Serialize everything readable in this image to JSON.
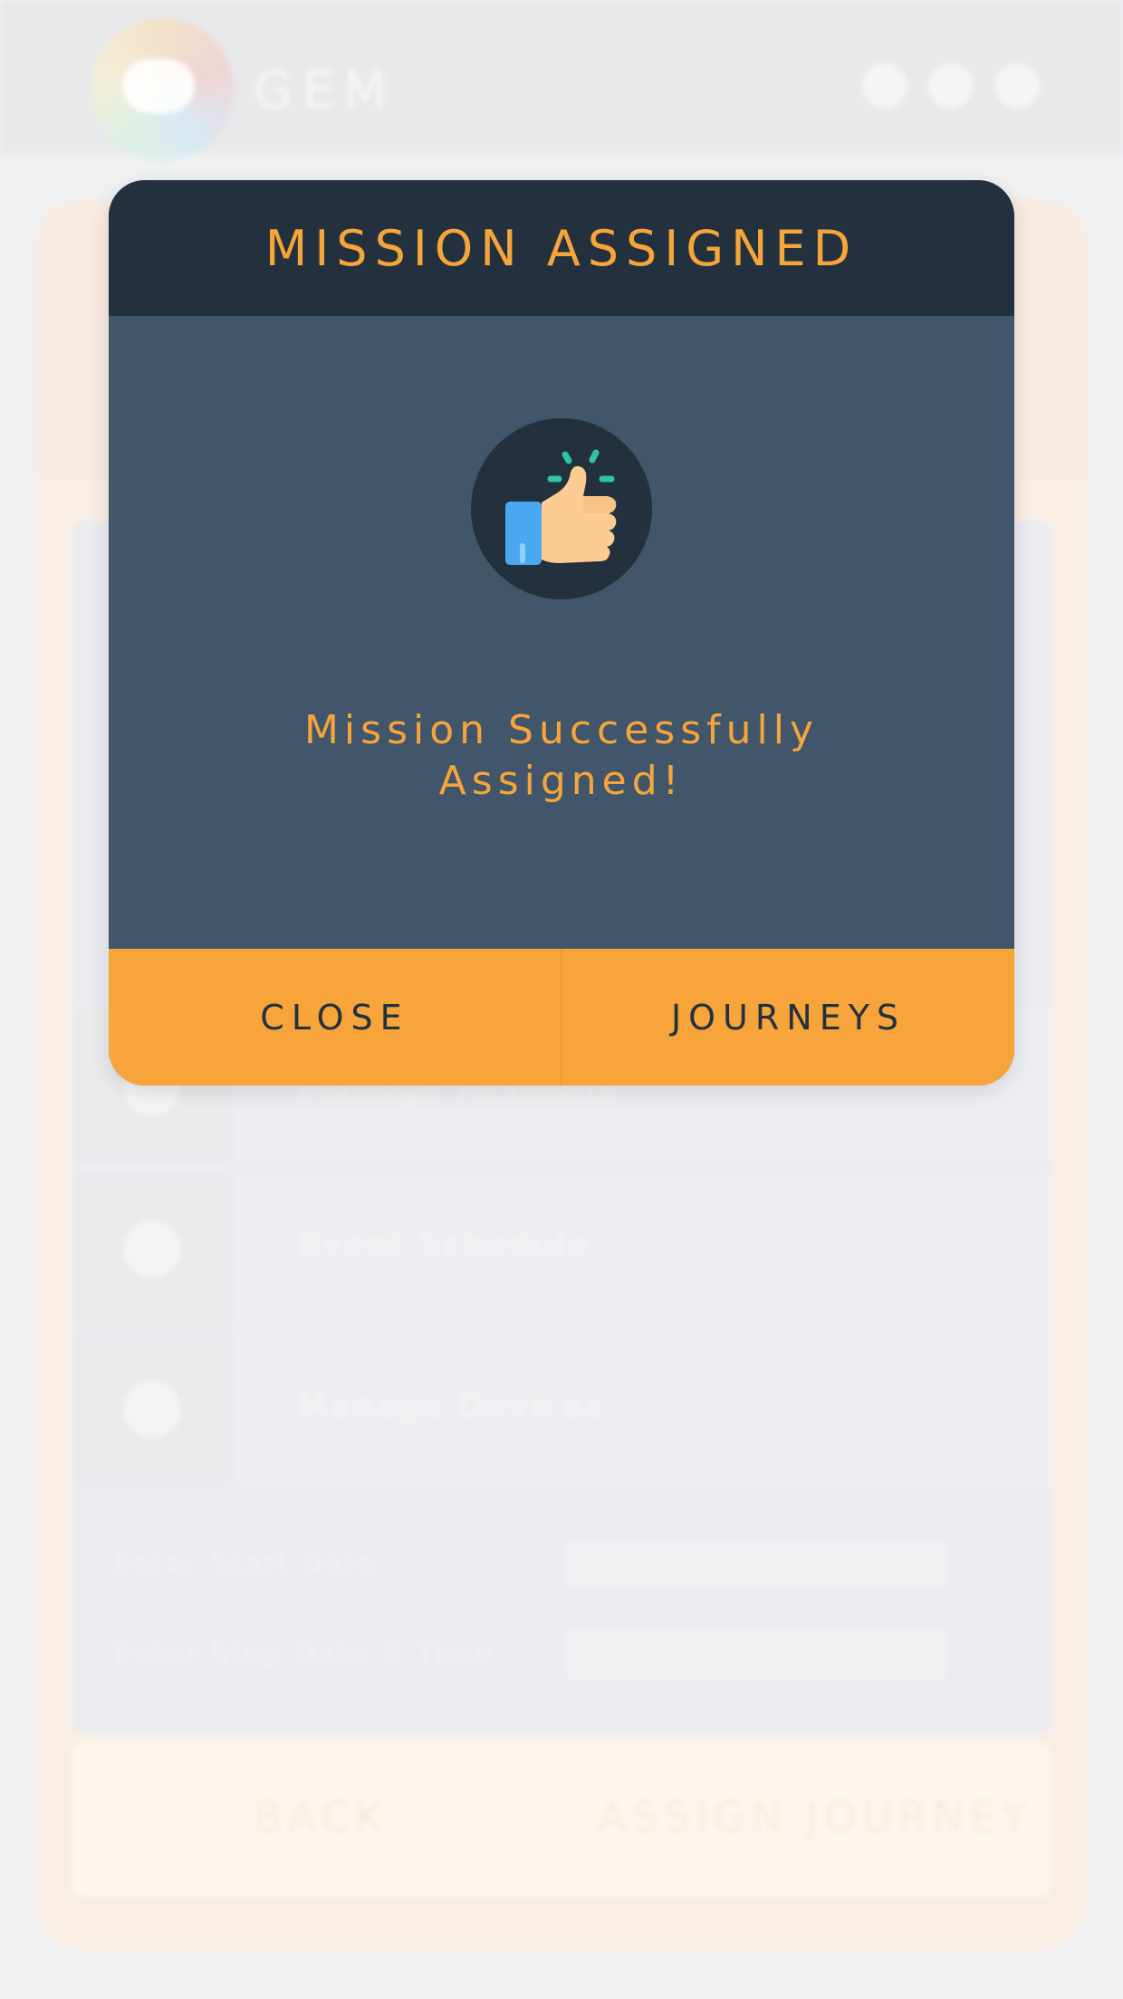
{
  "app": {
    "logo_text": "GEM"
  },
  "background": {
    "menu_items": [
      {
        "label": "Manage Missions",
        "icon": "mission-icon"
      },
      {
        "label": "Event Schedule",
        "icon": "pencil-icon"
      },
      {
        "label": "Manage Devices",
        "icon": "device-icon"
      }
    ],
    "fields": [
      {
        "label": "Enter Start Date"
      },
      {
        "label": "Enter Stop Date & Time"
      }
    ],
    "footer": {
      "back_label": "BACK",
      "assign_label": "ASSIGN JOURNEY"
    }
  },
  "modal": {
    "title": "MISSION ASSIGNED",
    "icon": "thumbs-up-icon",
    "message_line1": "Mission Successfully",
    "message_line2": "Assigned!",
    "close_label": "CLOSE",
    "journeys_label": "JOURNEYS"
  },
  "colors": {
    "accent": "#f6a53b",
    "header_dark": "#23303e",
    "modal_body": "#41566b",
    "footer_orange": "#f7a53a"
  }
}
